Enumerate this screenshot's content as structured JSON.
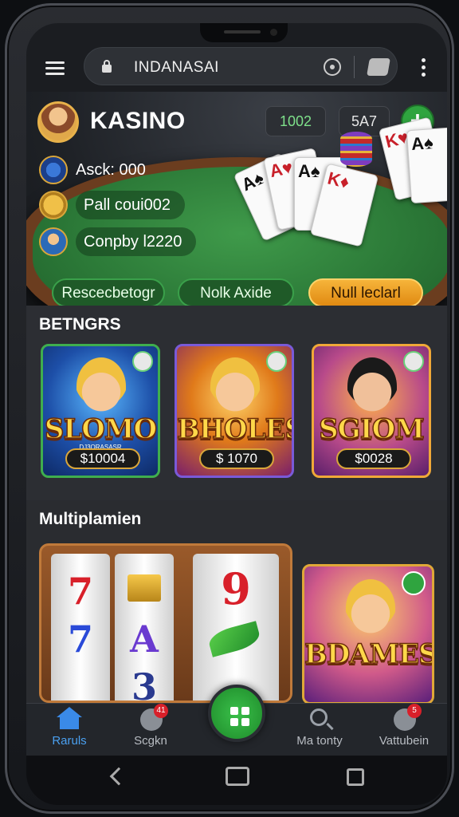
{
  "browser": {
    "url_text": "INDANASAI"
  },
  "header": {
    "title": "KASINO",
    "chip1": "1002",
    "chip2": "5A7",
    "plus_label": "+"
  },
  "stats": [
    {
      "label": "Asck: 000"
    },
    {
      "label": "Pall coui002"
    },
    {
      "label": "Conpby l2220"
    }
  ],
  "actions": [
    {
      "label": "Rescecbetogr"
    },
    {
      "label": "Nolk Axide"
    },
    {
      "label": "Null leclarl"
    }
  ],
  "section_betting": {
    "title": "BETNGRS",
    "games": [
      {
        "name": "SLOMO",
        "subtitle": "DJ3ORASASR",
        "price": "$10004"
      },
      {
        "name": "BHOLES",
        "subtitle": "",
        "price": "$ 1070"
      },
      {
        "name": "SGIOM",
        "subtitle": "",
        "price": "$0028"
      }
    ]
  },
  "section_multi": {
    "title": "Multiplamien",
    "featured_name": "BDAMES",
    "reel_symbols": [
      "7",
      "7",
      "A",
      "3",
      "9"
    ]
  },
  "bottom_nav": [
    {
      "label": "Raruls",
      "icon": "home-icon"
    },
    {
      "label": "Scgkn",
      "icon": "user-icon",
      "badge": "41"
    },
    {
      "label": "Ma tonty",
      "icon": "search-icon"
    },
    {
      "label": "Vattubein",
      "icon": "download-icon",
      "badge": "5"
    }
  ],
  "colors": {
    "accent_green": "#2fa43f",
    "accent_gold": "#f6b43a",
    "nav_active": "#4aa0f0"
  }
}
